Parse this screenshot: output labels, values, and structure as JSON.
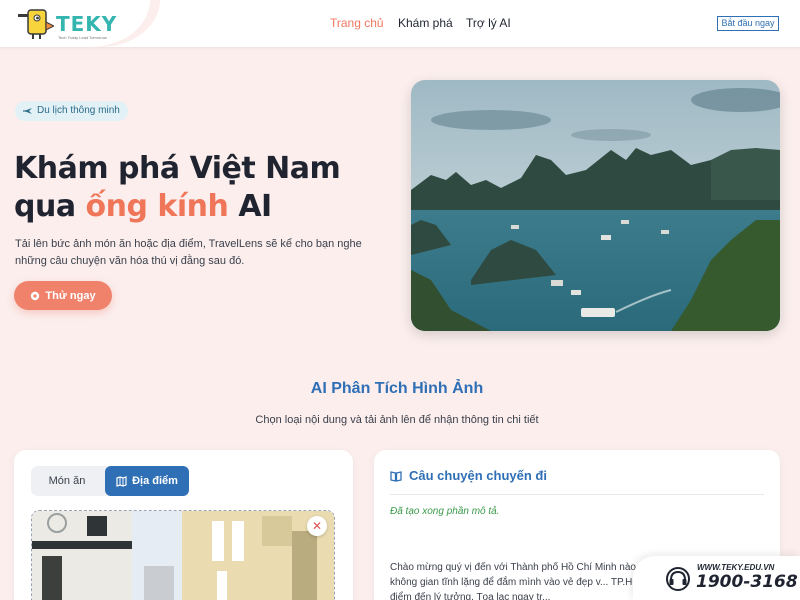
{
  "header": {
    "logo_text": "TEKY",
    "logo_subtext": "Tech Today Lead Tomorrow",
    "nav": {
      "home": "Trang chủ",
      "explore": "Khám phá",
      "ai": "Trợ lý AI"
    },
    "start_button": "Bắt đầu ngay"
  },
  "hero": {
    "badge": "Du lịch thông minh",
    "title_line1": "Khám phá Việt Nam",
    "title_prefix": "qua ",
    "title_highlight": "ống kính",
    "title_suffix": " AI",
    "description": "Tải lên bức ảnh món ăn hoặc địa điểm, TravelLens sẽ kể cho bạn nghe những câu chuyện văn hóa thú vị đằng sau đó.",
    "try_button": "Thử ngay"
  },
  "analysis": {
    "title": "AI Phân Tích Hình Ảnh",
    "subtitle": "Chọn loại nội dung và tải ảnh lên để nhận thông tin chi tiết",
    "tabs": {
      "food": "Món ăn",
      "place": "Địa điểm"
    },
    "remove_icon": "✕"
  },
  "story": {
    "title": "Câu chuyện chuyến đi",
    "status": "Đã tạo xong phần mô tả.",
    "body": "Chào mừng quý vị đến với Thành phố Hồ Chí Minh nào... một không gian tĩnh lặng để đắm mình vào vẻ đẹp v... TP.HCM chính là điểm đến lý tưởng. Tọa lạc ngay tr..."
  },
  "hotline": {
    "url": "WWW.TEKY.EDU.VN",
    "phone": "1900-3168"
  },
  "colors": {
    "accent": "#ef7659",
    "brand_blue": "#2f6fb5",
    "logo_teal": "#35b5b0",
    "background": "#fbeeed"
  }
}
